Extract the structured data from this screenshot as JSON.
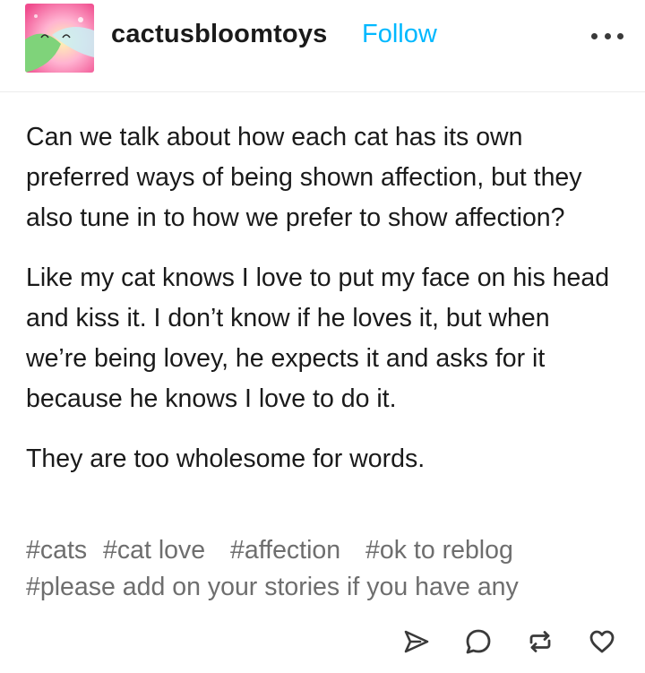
{
  "post": {
    "username": "cactusbloomtoys",
    "follow_label": "Follow",
    "paragraphs": [
      "Can we talk about how each cat has its own preferred ways of being shown affection, but they also tune in to how we prefer to show affection?",
      "Like my cat knows I love to put my face on his head and kiss it. I don’t know if he loves it, but when we’re being lovey, he expects it and asks for it because he knows I love to do it.",
      "They are too wholesome for words."
    ],
    "tags": [
      "#cats",
      "#cat love",
      "#affection",
      "#ok to reblog",
      "#please add on your stories if you have any"
    ]
  },
  "icons": {
    "avatar": "avatar-image",
    "more": "more-dots-icon",
    "share": "share-send-icon",
    "reply": "reply-bubble-icon",
    "reblog": "reblog-icon",
    "like": "heart-icon"
  },
  "colors": {
    "accent": "#00b8ff",
    "text": "#1a1a1a",
    "tags": "#6e6e6e",
    "icons": "#3a3a3a"
  }
}
